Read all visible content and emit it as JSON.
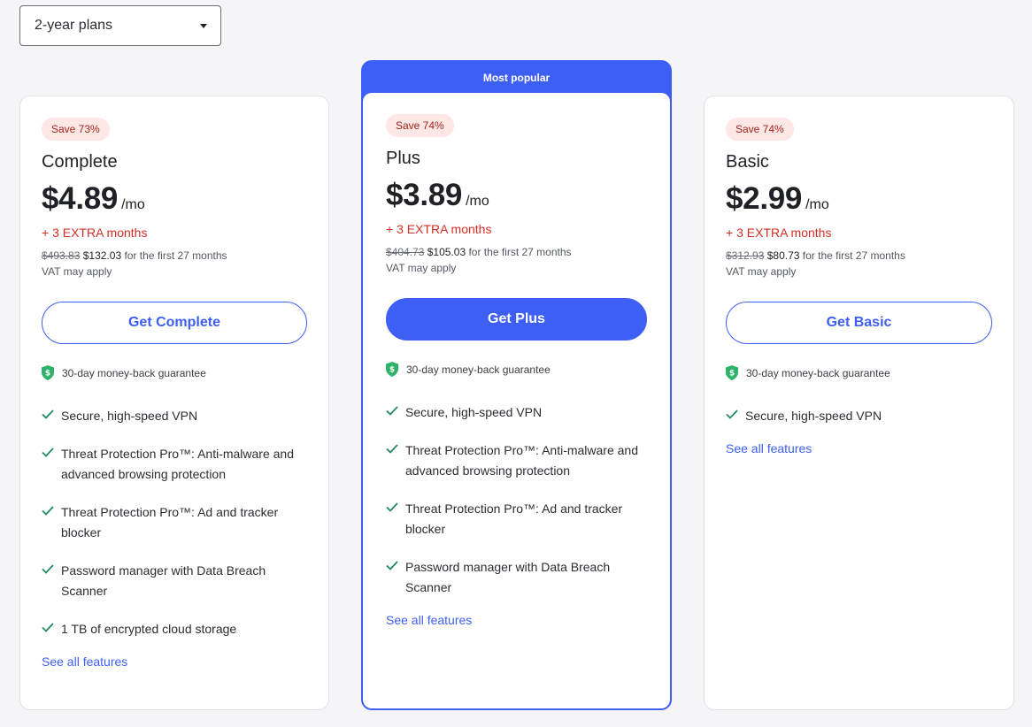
{
  "billing_selector": {
    "value": "2-year plans"
  },
  "popular_label": "Most popular",
  "guarantee_text": "30-day money-back guarantee",
  "see_all_label": "See all features",
  "colors": {
    "accent": "#3e5ff5",
    "discount_red": "#d32f24",
    "check_green": "#1f8a5c"
  },
  "plans": [
    {
      "badge": "Save 73%",
      "name": "Complete",
      "price": "$4.89",
      "per": "/mo",
      "extra": "+ 3 EXTRA months",
      "old_price": "$493.83",
      "new_price": "$132.03",
      "term": "for the first 27 months",
      "vat": "VAT may apply",
      "cta": "Get Complete",
      "features": [
        "Secure, high-speed VPN",
        "Threat Protection Pro™: Anti-malware and advanced browsing protection",
        "Threat Protection Pro™: Ad and tracker blocker",
        "Password manager with Data Breach Scanner",
        "1 TB of encrypted cloud storage"
      ]
    },
    {
      "badge": "Save 74%",
      "name": "Plus",
      "price": "$3.89",
      "per": "/mo",
      "extra": "+ 3 EXTRA months",
      "old_price": "$404.73",
      "new_price": "$105.03",
      "term": "for the first 27 months",
      "vat": "VAT may apply",
      "cta": "Get Plus",
      "features": [
        "Secure, high-speed VPN",
        "Threat Protection Pro™: Anti-malware and advanced browsing protection",
        "Threat Protection Pro™: Ad and tracker blocker",
        "Password manager with Data Breach Scanner"
      ]
    },
    {
      "badge": "Save 74%",
      "name": "Basic",
      "price": "$2.99",
      "per": "/mo",
      "extra": "+ 3 EXTRA months",
      "old_price": "$312.93",
      "new_price": "$80.73",
      "term": "for the first 27 months",
      "vat": "VAT may apply",
      "cta": "Get Basic",
      "features": [
        "Secure, high-speed VPN"
      ]
    }
  ]
}
